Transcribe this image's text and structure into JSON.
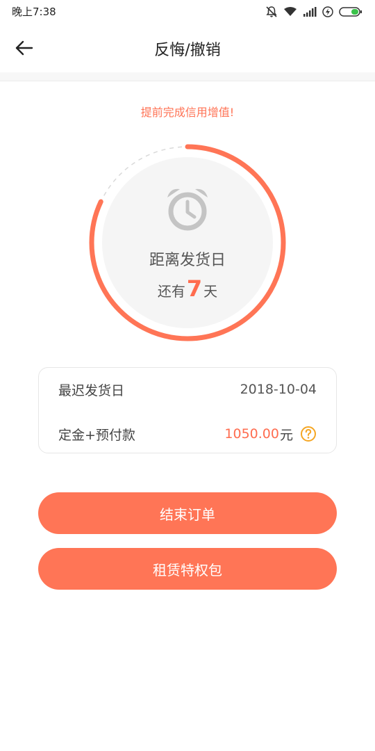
{
  "status_bar": {
    "time": "晚上7:38",
    "icons": [
      "silent-icon",
      "wifi-icon",
      "signal-icon",
      "charging-icon",
      "battery-icon"
    ]
  },
  "header": {
    "title": "反悔/撤销",
    "back_icon": "arrow-left-icon"
  },
  "promo": {
    "text": "提前完成信用增值!"
  },
  "countdown": {
    "label": "距离发货日",
    "remaining_prefix": "还有",
    "days": "7",
    "remaining_suffix": "天",
    "progress_fraction": 0.82,
    "icon": "alarm-clock-icon"
  },
  "info": {
    "ship_date_label": "最迟发货日",
    "ship_date_value": "2018-10-04",
    "payment_label": "定金+预付款",
    "payment_amount": "1050.00",
    "payment_unit": "元",
    "help_icon": "question-circle-icon"
  },
  "buttons": {
    "end_order": "结束订单",
    "lease_package": "租赁特权包"
  },
  "colors": {
    "accent": "#ff7556",
    "accent_text": "#ff6c4f",
    "help": "#f5a623",
    "ring_track": "#d9d9d9",
    "disc": "#f5f5f5"
  }
}
